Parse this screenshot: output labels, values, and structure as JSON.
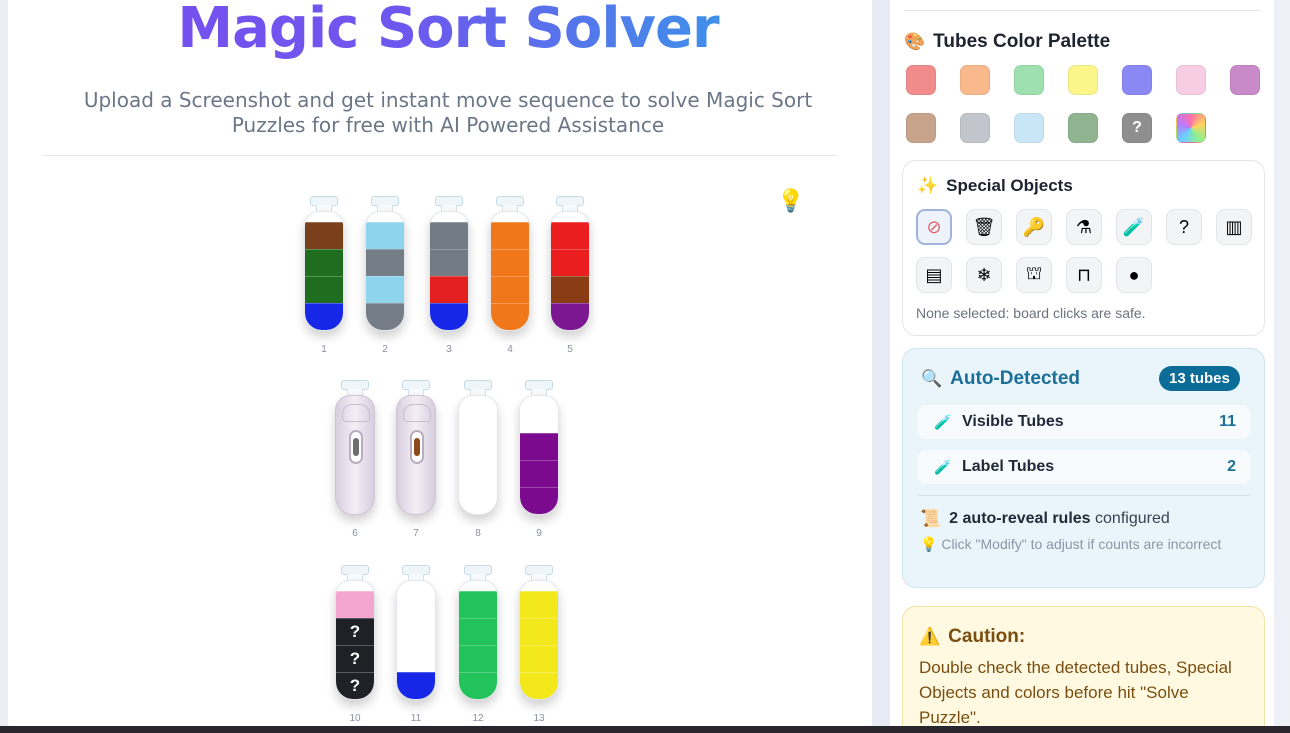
{
  "header": {
    "title": "Magic Sort Solver",
    "subtitle_line1": "Upload a Screenshot and get instant move sequence to solve Magic Sort",
    "subtitle_line2": "Puzzles for free with AI Powered Assistance"
  },
  "tubes": [
    {
      "num": "1",
      "segments": [
        "#7a3f1b",
        "#1f6e1f",
        "#1f6e1f",
        "#1727e8"
      ]
    },
    {
      "num": "2",
      "segments": [
        "#8ed4ec",
        "#747c86",
        "#8ed4ec",
        "#747c86"
      ]
    },
    {
      "num": "3",
      "segments": [
        "#737b85",
        "#737b85",
        "#e31f1f",
        "#1727e8"
      ]
    },
    {
      "num": "4",
      "segments": [
        "#f0781b",
        "#f0781b",
        "#f0781b",
        "#f0781b"
      ]
    },
    {
      "num": "5",
      "segments": [
        "#ea1e1e",
        "#ea1e1e",
        "#8a3d14",
        "#7b1790"
      ]
    },
    {
      "num": "6",
      "type": "locked",
      "inner": "#6e6e6e"
    },
    {
      "num": "7",
      "type": "locked",
      "inner": "#8a4a1c"
    },
    {
      "num": "8",
      "segments": []
    },
    {
      "num": "9",
      "segments": [
        "#7b0a8e",
        "#7b0a8e",
        "#7b0a8e"
      ]
    },
    {
      "num": "10",
      "segments": [
        "#f5a6d0",
        "?",
        "?",
        "?"
      ]
    },
    {
      "num": "11",
      "segments": [
        "#1727e8"
      ]
    },
    {
      "num": "12",
      "segments": [
        "#22c35a",
        "#22c35a",
        "#22c35a",
        "#22c35a"
      ]
    },
    {
      "num": "13",
      "segments": [
        "#f2e81c",
        "#f2e81c",
        "#f2e81c",
        "#f2e81c"
      ]
    }
  ],
  "palette": {
    "title": "Tubes Color Palette",
    "colors": [
      "#f28c8c",
      "#f9b98c",
      "#9ee0b0",
      "#fbf58a",
      "#8a88f4",
      "#f7cde4",
      "#c88ac8",
      "#c9a48c",
      "#c2c6cc",
      "#c9e6f6",
      "#8fb48f",
      "unknown",
      "rainbow"
    ],
    "unknown_label": "?"
  },
  "special_objects": {
    "title": "Special Objects",
    "icons": [
      "no-selection-icon",
      "trash-icon",
      "key-icon",
      "potion-icon",
      "label-tube-icon",
      "mystery-icon",
      "wood-tube-icon",
      "crate-icon",
      "ice-icon",
      "castle-icon",
      "stand-icon",
      "orb-icon"
    ],
    "glyphs": [
      "⊘",
      "🗑",
      "🔑",
      "⚗",
      "🧪",
      "?",
      "▥",
      "▤",
      "❄",
      "⛫",
      "⊓",
      "●"
    ],
    "note": "None selected: board clicks are safe."
  },
  "auto_detected": {
    "title": "Auto-Detected",
    "badge": "13 tubes",
    "rows": [
      {
        "label": "Visible Tubes",
        "count": "11"
      },
      {
        "label": "Label Tubes",
        "count": "2"
      }
    ],
    "rules_count": "2 auto-reveal rules",
    "rules_suffix": "configured",
    "tip": "Click \"Modify\" to adjust if counts are incorrect"
  },
  "caution": {
    "title": "Caution:",
    "text": "Double check the detected tubes, Special Objects and colors before hit \"Solve Puzzle\"."
  },
  "colors": {
    "accent_purple": "#7a4cf0",
    "accent_blue": "#27aee6",
    "auto_blue": "#0c6c98",
    "caution_brown": "#7a4e10"
  }
}
